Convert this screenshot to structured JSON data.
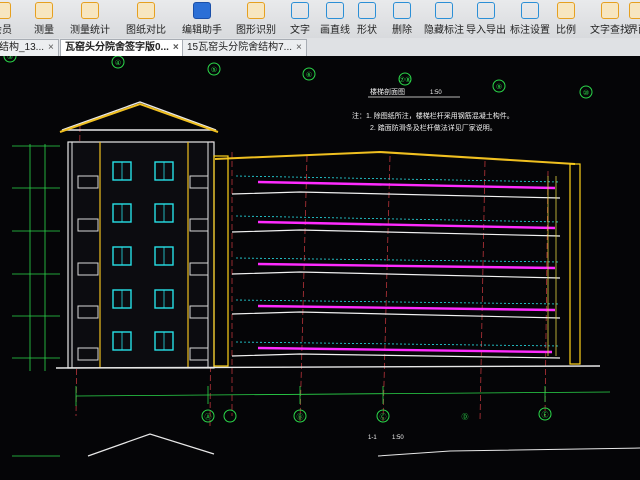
{
  "toolbar": {
    "items": [
      {
        "label": "会员",
        "icon": "member-icon"
      },
      {
        "label": "测量",
        "icon": "measure-icon"
      },
      {
        "label": "测量统计",
        "icon": "measure-stats-icon"
      },
      {
        "label": "图纸对比",
        "icon": "compare-icon"
      },
      {
        "label": "编辑助手",
        "icon": "edit-assistant-icon"
      },
      {
        "label": "图形识别",
        "icon": "shape-recognition-icon"
      },
      {
        "label": "文字",
        "icon": "text-icon"
      },
      {
        "label": "画直线",
        "icon": "draw-line-icon"
      },
      {
        "label": "形状",
        "icon": "shape-icon"
      },
      {
        "label": "删除",
        "icon": "eraser-icon"
      },
      {
        "label": "隐藏标注",
        "icon": "hide-annotation-icon"
      },
      {
        "label": "导入导出",
        "icon": "import-export-icon"
      },
      {
        "label": "标注设置",
        "icon": "annotation-settings-icon"
      },
      {
        "label": "比例",
        "icon": "scale-icon"
      },
      {
        "label": "文字查找",
        "icon": "text-search-icon"
      },
      {
        "label": "界面",
        "icon": "interface-icon"
      }
    ]
  },
  "tabs": [
    {
      "label": "结构_13...",
      "active": false
    },
    {
      "label": "瓦窑头分院舍签字版0...",
      "active": true
    },
    {
      "label": "15瓦窑头分院舍结构7...",
      "active": false
    }
  ],
  "drawing": {
    "axis_labels_top": [
      "③",
      "④",
      "⑤",
      "⑥",
      "⑦⑧",
      "⑨",
      "⑩"
    ],
    "axis_labels_bottom": [
      "Ⓐ",
      "Ⓑ",
      "Ⓒ",
      "Ⓓ",
      "Ⓔ"
    ],
    "section_title": "楼梯剖面图",
    "section_scale": "1:50",
    "notes": [
      "注：1. 除图纸所注，楼梯栏杆采用钢筋混凝土构件。",
      "2. 踏面防滑条及栏杆做法详见厂家说明。"
    ],
    "bottom_title": "1-1",
    "bottom_scale": "1:50",
    "colors": {
      "background": "#050507",
      "wall": "#f2f2f2",
      "slab": "#ff2bff",
      "window": "#27e0e6",
      "axis": "#2bd84a",
      "roof": "#f0c020",
      "column": "#ffd21a",
      "red_line": "#d02a2a"
    }
  }
}
